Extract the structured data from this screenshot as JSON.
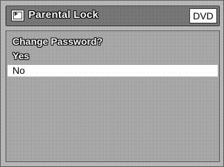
{
  "header": {
    "title": "Parental Lock",
    "media": "DVD",
    "icon": "menu-icon"
  },
  "dialog": {
    "question": "Change Password?",
    "options": [
      {
        "label": "Yes",
        "selected": false
      },
      {
        "label": "No",
        "selected": true
      }
    ]
  },
  "colors": {
    "highlight": "#ffffff",
    "text_outline": "#000000",
    "background": "#c9c9c9"
  }
}
